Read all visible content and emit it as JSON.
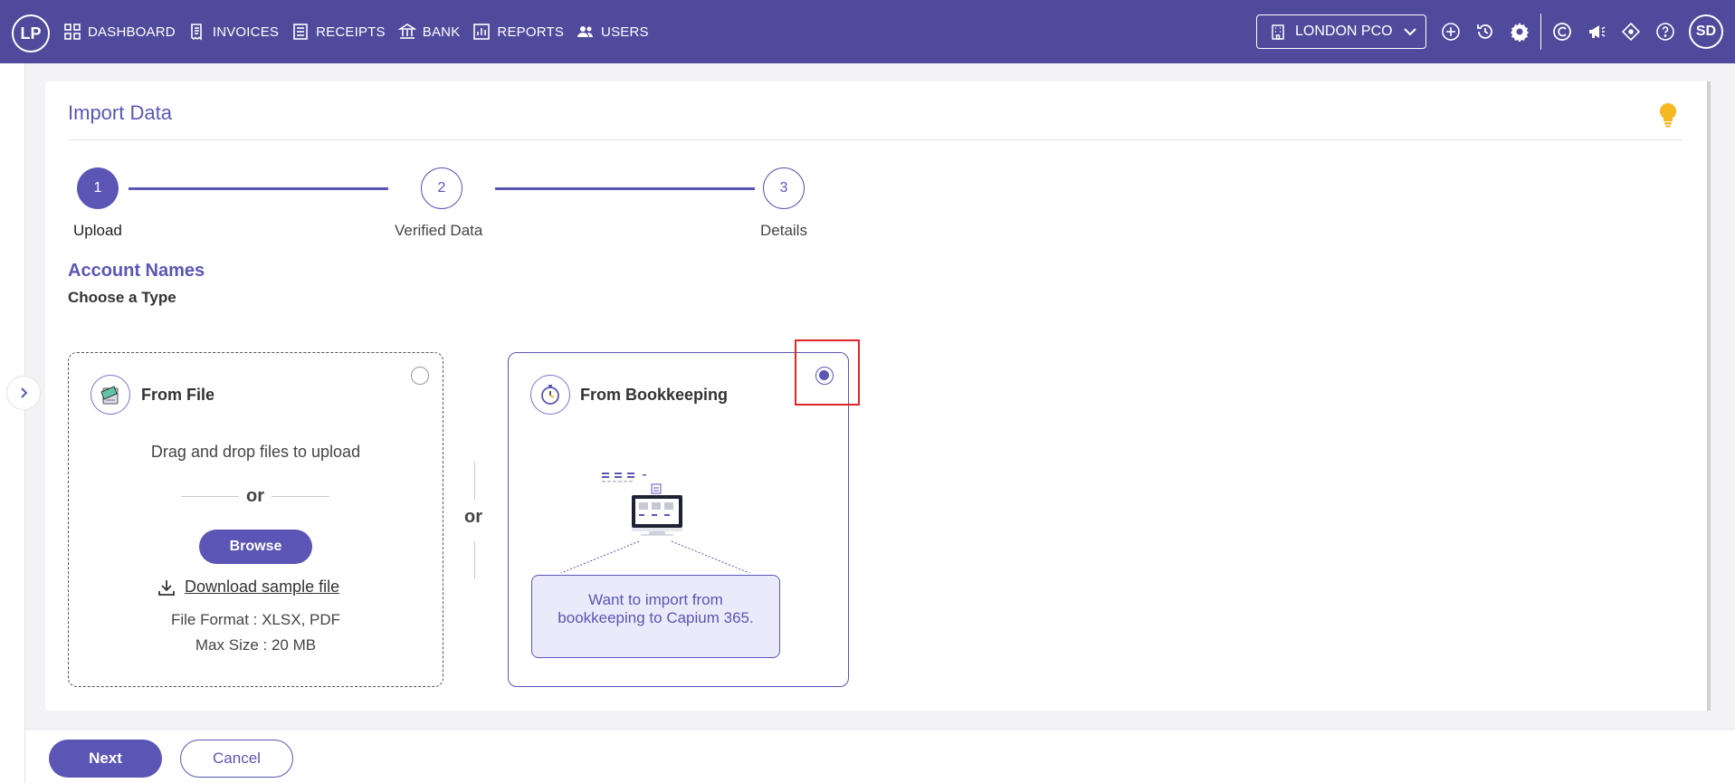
{
  "header": {
    "logo": "LP",
    "nav": [
      {
        "label": "DASHBOARD",
        "icon": "dashboard-icon"
      },
      {
        "label": "INVOICES",
        "icon": "invoice-icon"
      },
      {
        "label": "RECEIPTS",
        "icon": "receipt-icon"
      },
      {
        "label": "BANK",
        "icon": "bank-icon"
      },
      {
        "label": "REPORTS",
        "icon": "reports-icon"
      },
      {
        "label": "USERS",
        "icon": "users-icon"
      }
    ],
    "company": "LONDON PCO",
    "avatar": "SD"
  },
  "page": {
    "title": "Import Data",
    "steps": [
      {
        "number": "1",
        "label": "Upload",
        "active": true
      },
      {
        "number": "2",
        "label": "Verified Data",
        "active": false
      },
      {
        "number": "3",
        "label": "Details",
        "active": false
      }
    ],
    "section_title": "Account Names",
    "section_subtitle": "Choose a Type"
  },
  "file_option": {
    "title": "From File",
    "selected": false,
    "drag_text": "Drag and drop files to upload",
    "or_text": "or",
    "browse_label": "Browse",
    "download_label": "Download sample file",
    "format_text": "File Format : XLSX, PDF",
    "size_text": "Max Size : 20 MB"
  },
  "middle_or": "or",
  "bookkeeping_option": {
    "title": "From Bookkeeping",
    "selected": true,
    "callout": "Want to import from bookkeeping to Capium 365."
  },
  "footer": {
    "next_label": "Next",
    "cancel_label": "Cancel"
  },
  "colors": {
    "brand": "#4f4a9b",
    "accent": "#5b56b5",
    "highlight": "#e0262a",
    "bulb": "#f5b820"
  }
}
